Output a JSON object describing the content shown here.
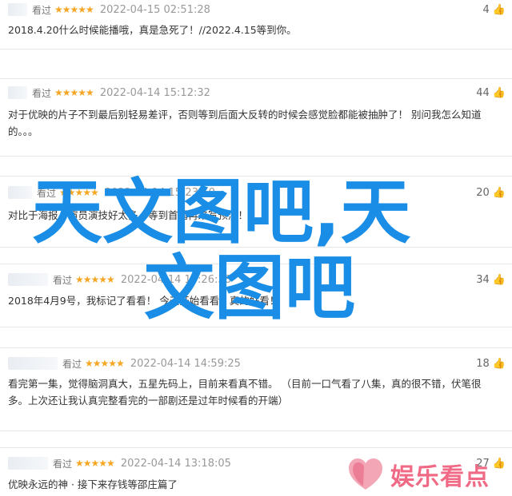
{
  "colors": {
    "star": "#f5a623",
    "watermark": "#1a8ee6",
    "logo": "#f06a86"
  },
  "reviews": [
    {
      "user": "看过",
      "stars": "★★★★★",
      "date": "2022-04-15 02:51:28",
      "likes": "4",
      "text": "2018.4.20什么时候能播哦，真是急死了！//2022.4.15等到你。"
    },
    {
      "user": "看过",
      "stars": "★★★★★",
      "date": "2022-04-14 15:12:32",
      "likes": "44",
      "text": "对于优映的片子不到最后别轻易差评，否则等到后面大反转的时候会感觉脸都能被抽肿了！ 别问我怎么知道的。。。"
    },
    {
      "user": "看过",
      "stars": "★★★★★",
      "date": "2022-04-14 15:23:10",
      "likes": "20",
      "text": "对比于海报，演员演技好太多，等到首播再来写预测！"
    },
    {
      "user": "看过",
      "stars": "★★★★★",
      "date": "2022-04-14 14:26:38",
      "likes": "34",
      "text": "2018年4月9号，我标记了看看！ 今天开始看看，真的好看！"
    },
    {
      "user": "看过",
      "stars": "★★★★★",
      "date": "2022-04-14 14:59:25",
      "likes": "18",
      "text": "看完第一集，觉得脑洞真大，五星先码上，目前来看真不错。 （目前一口气看了八集，真的很不错，伏笔很多。上次还让我认真完整看完的一部剧还是过年时候看的开端）"
    },
    {
      "user": "看过",
      "stars": "★★★★★",
      "date": "2022-04-14 13:18:05",
      "likes": "27",
      "text": "优映永远的神 · 接下来存钱等邵庄篇了"
    }
  ],
  "watermark": {
    "line1": "天文图吧,天",
    "line2": "文图吧"
  },
  "logo": {
    "text": "娱乐看点",
    "icon": "heart-icon"
  },
  "icons": {
    "like": "thumbs-up-icon"
  }
}
